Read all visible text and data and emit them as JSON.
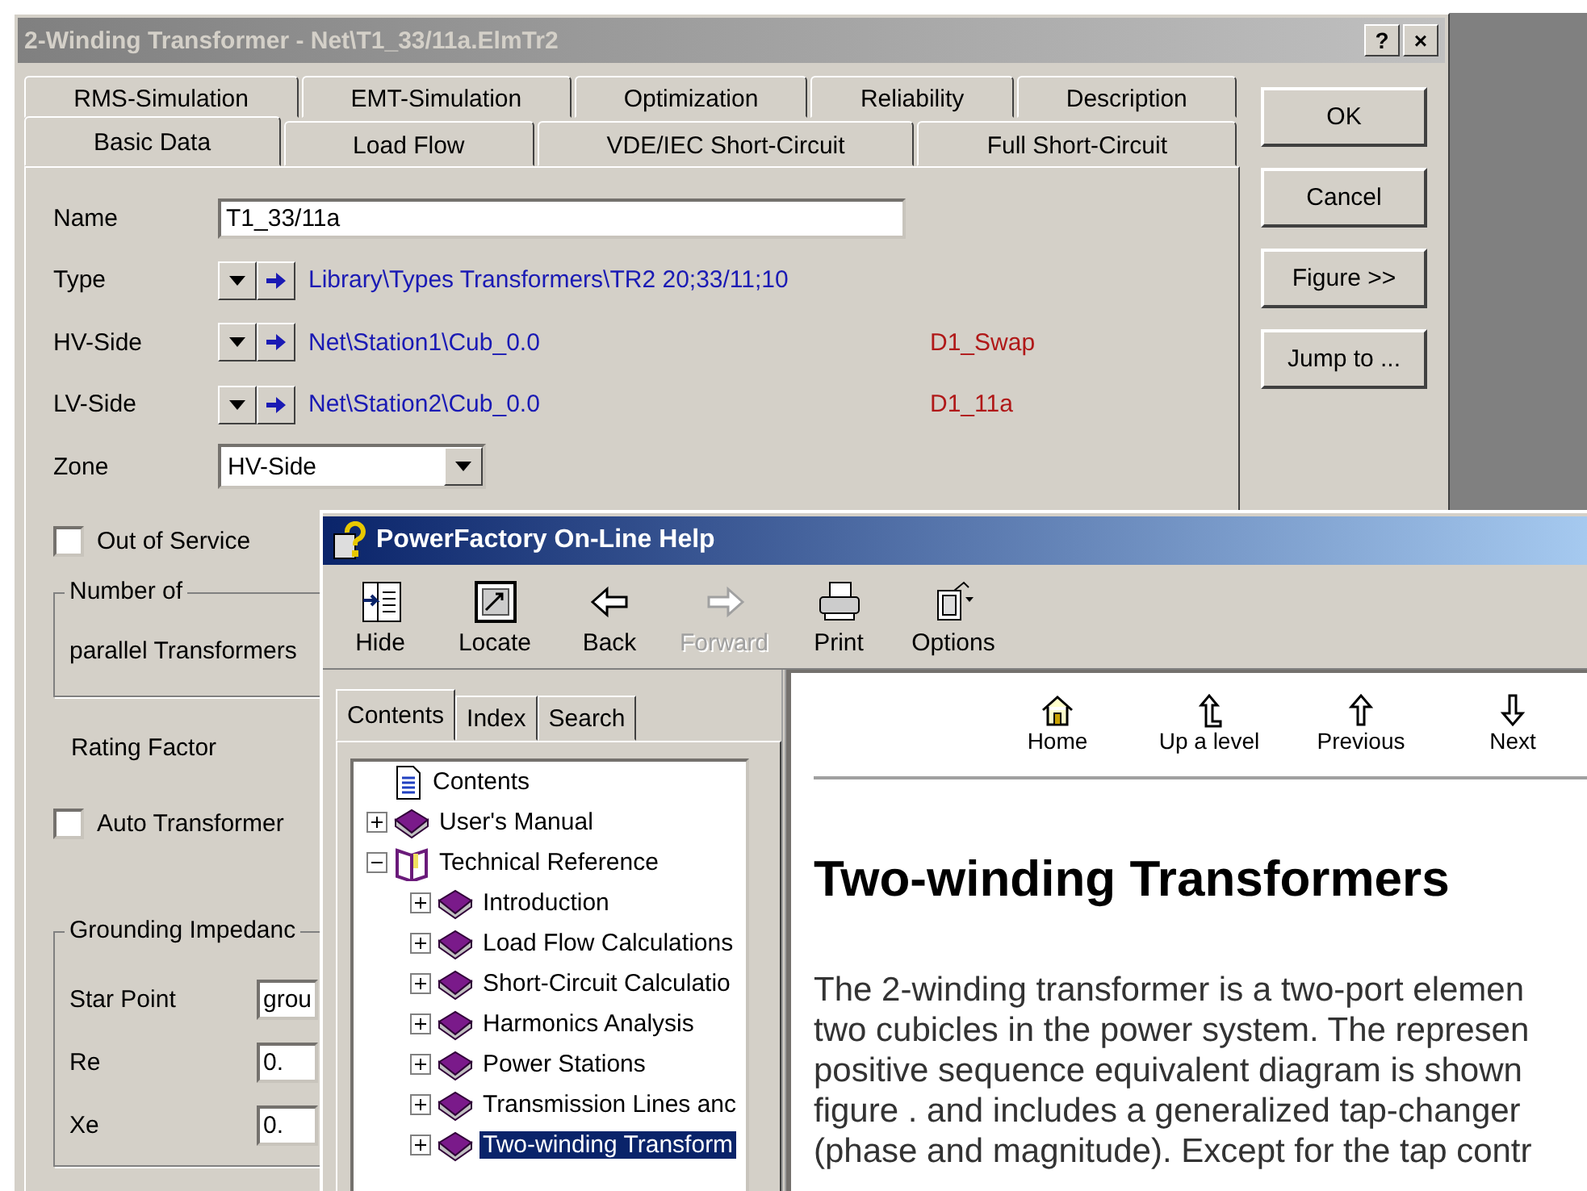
{
  "dialog": {
    "title": "2-Winding Transformer - Net\\T1_33/11a.ElmTr2",
    "title_buttons": [
      "?",
      "×"
    ],
    "tab_rows": [
      [
        {
          "label": "RMS-Simulation",
          "selected": false
        },
        {
          "label": "EMT-Simulation",
          "selected": false
        },
        {
          "label": "Optimization",
          "selected": false
        },
        {
          "label": "Reliability",
          "selected": false
        },
        {
          "label": "Description",
          "selected": false
        }
      ],
      [
        {
          "label": "Basic Data",
          "selected": true
        },
        {
          "label": "Load Flow",
          "selected": false
        },
        {
          "label": "VDE/IEC Short-Circuit",
          "selected": false
        },
        {
          "label": "Full Short-Circuit",
          "selected": false
        }
      ]
    ],
    "name": {
      "label": "Name",
      "value": "T1_33/11a"
    },
    "references": [
      {
        "label": "Type",
        "path": "Library\\Types Transformers\\TR2 20;33/11;10"
      },
      {
        "label": "HV-Side",
        "path": "Net\\Station1\\Cub_0.0",
        "tag": "D1_Swap"
      },
      {
        "label": "LV-Side",
        "path": "Net\\Station2\\Cub_0.0",
        "tag": "D1_11a"
      }
    ],
    "zone": {
      "label": "Zone",
      "value": "HV-Side"
    },
    "out_of_service": {
      "label": "Out of Service",
      "checked": false
    },
    "parallel_group": {
      "title": "Number of",
      "label": "parallel Transformers"
    },
    "rating_factor": {
      "label": "Rating Factor"
    },
    "auto_transformer": {
      "label": "Auto Transformer",
      "checked": false
    },
    "grounding": {
      "title": "Grounding Impedanc",
      "fields": [
        {
          "label": "Star Point",
          "value": "grou"
        },
        {
          "label": "Re",
          "value": "0."
        },
        {
          "label": "Xe",
          "value": "0."
        }
      ]
    },
    "buttons": [
      "OK",
      "Cancel",
      "Figure >>",
      "Jump to ..."
    ]
  },
  "help": {
    "title": "PowerFactory On-Line Help",
    "toolbar": [
      {
        "label": "Hide",
        "disabled": false
      },
      {
        "label": "Locate",
        "disabled": false
      },
      {
        "label": "Back",
        "disabled": false
      },
      {
        "label": "Forward",
        "disabled": true
      },
      {
        "label": "Print",
        "disabled": false
      },
      {
        "label": "Options",
        "disabled": false
      }
    ],
    "tabs": [
      {
        "label": "Contents",
        "selected": true
      },
      {
        "label": "Index",
        "selected": false
      },
      {
        "label": "Search",
        "selected": false
      }
    ],
    "tree": [
      {
        "label": "Contents",
        "kind": "page",
        "selected": false
      },
      {
        "label": "User's Manual",
        "kind": "book",
        "expanded": false,
        "selected": false
      },
      {
        "label": "Technical Reference",
        "kind": "book",
        "expanded": true,
        "selected": false,
        "children": [
          {
            "label": "Introduction",
            "kind": "book",
            "expanded": false,
            "selected": false
          },
          {
            "label": "Load Flow Calculations",
            "kind": "book",
            "expanded": false,
            "selected": false
          },
          {
            "label": "Short-Circuit Calculatio",
            "kind": "book",
            "expanded": false,
            "selected": false
          },
          {
            "label": "Harmonics Analysis",
            "kind": "book",
            "expanded": false,
            "selected": false
          },
          {
            "label": "Power Stations",
            "kind": "book",
            "expanded": false,
            "selected": false
          },
          {
            "label": "Transmission Lines anc",
            "kind": "book",
            "expanded": false,
            "selected": false
          },
          {
            "label": "Two-winding Transform",
            "kind": "book",
            "expanded": false,
            "selected": true
          }
        ]
      }
    ],
    "nav": [
      {
        "label": "Home"
      },
      {
        "label": "Up a level"
      },
      {
        "label": "Previous"
      },
      {
        "label": "Next"
      }
    ],
    "heading": "Two-winding Transformers",
    "paragraph_lines": [
      "The 2-winding transformer is a two-port elemen",
      "two cubicles in the power system. The represen",
      "positive sequence equivalent diagram is shown",
      "figure . and includes a generalized tap-changer",
      "(phase and magnitude). Except for the tap contr"
    ]
  }
}
